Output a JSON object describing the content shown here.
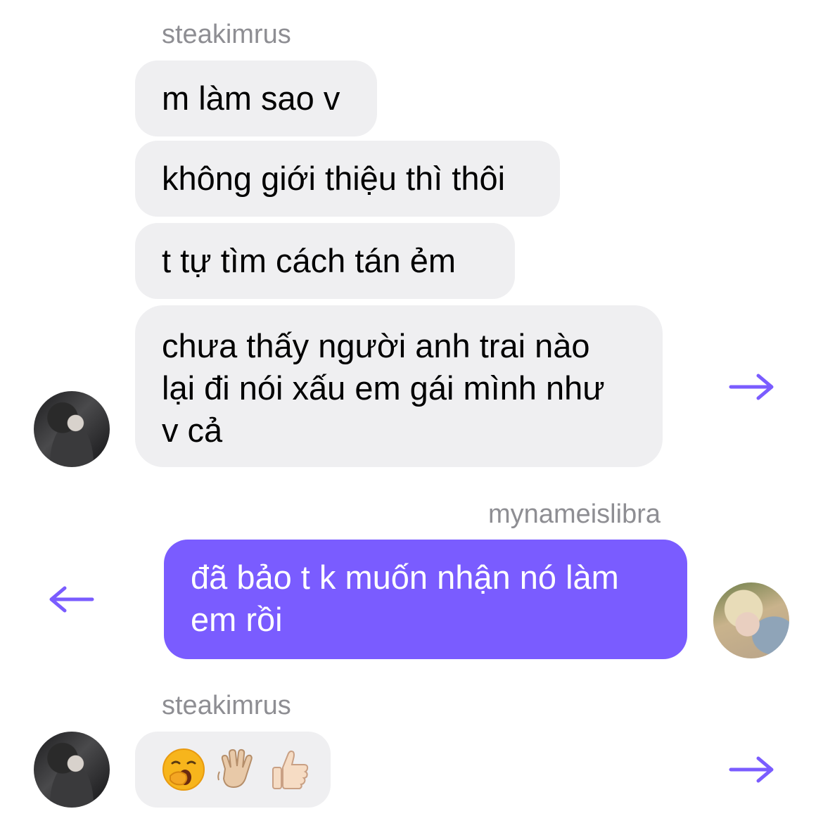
{
  "messages": [
    {
      "sender": "steakimrus",
      "bubbles": [
        "m làm sao v",
        "không giới thiệu thì thôi",
        "t tự tìm cách tán ẻm",
        [
          "chưa thấy người anh trai nào",
          "lại đi nói xấu em gái mình như",
          "v cả"
        ]
      ]
    },
    {
      "sender": "mynameislibra",
      "bubbles": [
        [
          "đã bảo t k muốn nhận nó làm",
          "em rồi"
        ]
      ]
    },
    {
      "sender": "steakimrus",
      "emojis": [
        "yawning-face",
        "waving-hand-light-skin",
        "thumbs-up-light-skin"
      ]
    }
  ],
  "colors": {
    "outgoing_bubble": "#7a5cff",
    "incoming_bubble": "#efeff1",
    "arrow": "#7a5cff",
    "sender_name": "#8e8e93"
  },
  "icons": {
    "forward_arrow": "arrow-right-icon",
    "back_arrow": "arrow-left-icon"
  }
}
